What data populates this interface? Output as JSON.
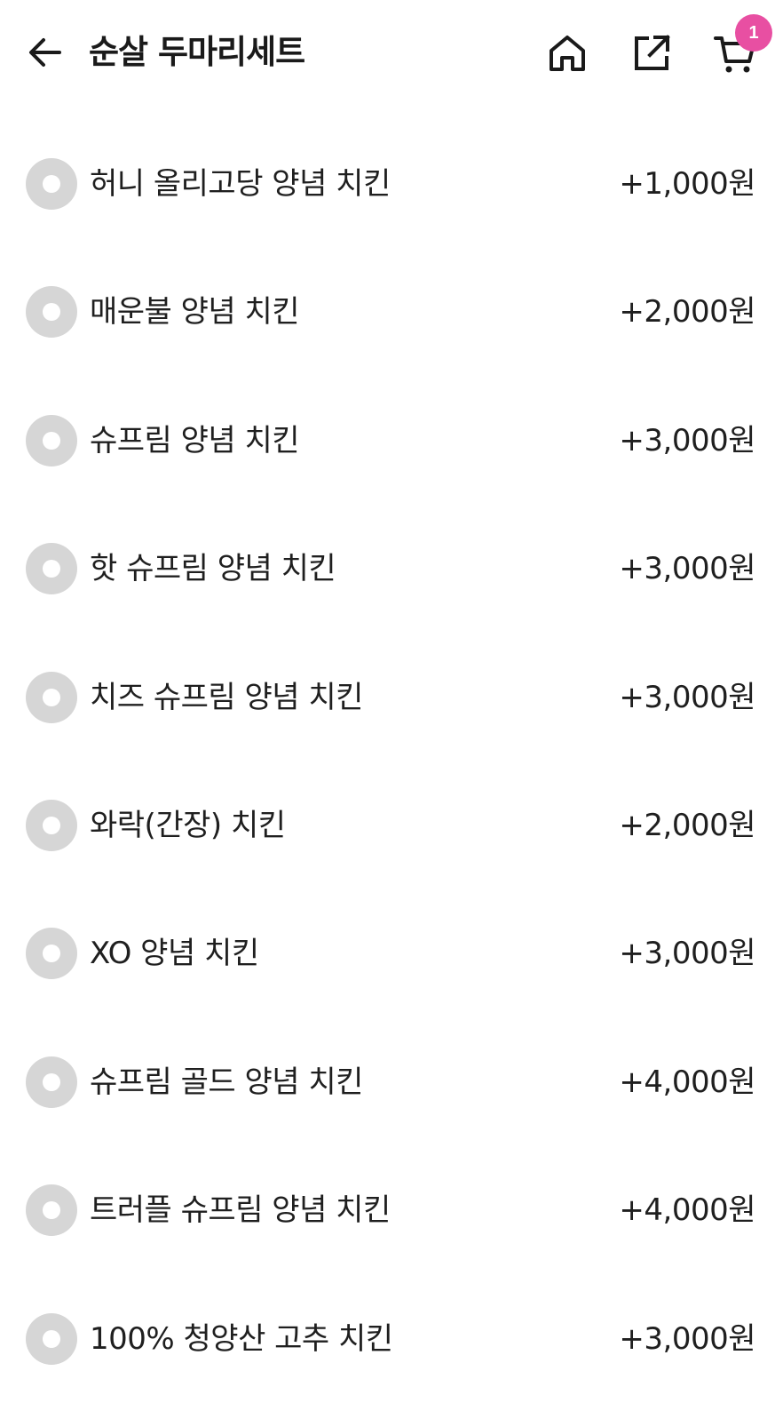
{
  "header": {
    "title": "순살 두마리세트",
    "cart_count": "1"
  },
  "colors": {
    "badge": "#e84fa2",
    "radio": "#d6d6d6",
    "text": "#1f1f1f"
  },
  "options": [
    {
      "label": "허니 올리고당 양념 치킨",
      "price": "+1,000원"
    },
    {
      "label": "매운불 양념 치킨",
      "price": "+2,000원"
    },
    {
      "label": "슈프림 양념 치킨",
      "price": "+3,000원"
    },
    {
      "label": "핫 슈프림 양념 치킨",
      "price": "+3,000원"
    },
    {
      "label": "치즈 슈프림 양념 치킨",
      "price": "+3,000원"
    },
    {
      "label": "와락(간장) 치킨",
      "price": "+2,000원"
    },
    {
      "label": "XO 양념 치킨",
      "price": "+3,000원"
    },
    {
      "label": "슈프림 골드 양념 치킨",
      "price": "+4,000원"
    },
    {
      "label": "트러플 슈프림 양념 치킨",
      "price": "+4,000원"
    },
    {
      "label": "100% 청양산 고추 치킨",
      "price": "+3,000원"
    }
  ]
}
